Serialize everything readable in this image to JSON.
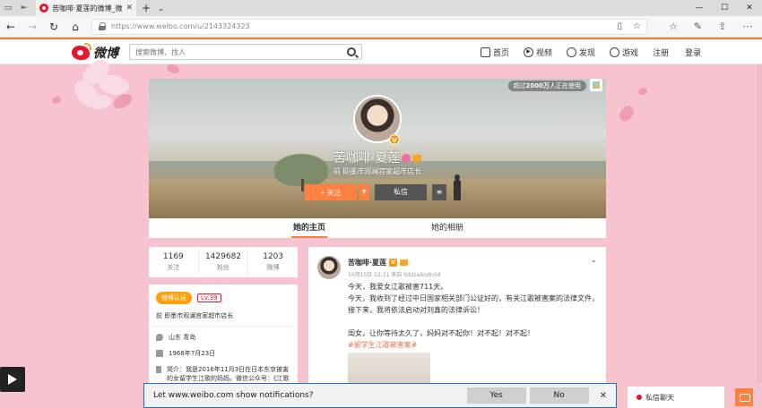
{
  "browser": {
    "tab_title": "苦咖啡·夏莲的微博_微博",
    "url_domain": "https://www.weibo.com",
    "url_path": "/u/2143324323"
  },
  "header": {
    "logo_text": "微博",
    "search_placeholder": "搜索微博、找人",
    "nav": [
      {
        "label": "首页",
        "icon": "home-icon"
      },
      {
        "label": "视频",
        "icon": "video-icon"
      },
      {
        "label": "发现",
        "icon": "compass-icon"
      },
      {
        "label": "游戏",
        "icon": "game-icon"
      }
    ],
    "register": "注册",
    "login": "登录"
  },
  "profile": {
    "live_badge_pre": "超过",
    "live_badge_num": "2000万",
    "live_badge_post": "人正在使用",
    "name": "苦咖啡·夏莲",
    "description": "前 即墨市观澜宫家超市店长",
    "follow_label": "+ 关注",
    "message_label": "私信",
    "tabs": [
      "她的主页",
      "她的相册"
    ]
  },
  "stats": [
    {
      "num": "1169",
      "label": "关注"
    },
    {
      "num": "1429682",
      "label": "粉丝"
    },
    {
      "num": "1203",
      "label": "微博"
    }
  ],
  "info": {
    "verified": "微博认证",
    "level": "Lv.39",
    "intro": "前 即墨市观澜宫家超市店长",
    "location": "山东 青岛",
    "birthday": "1968年7月23日",
    "bio": "简介：我是2016年11月3日在日本东京被害的女留学生江歌的妈妈。微信公众号：《江歌妈"
  },
  "post": {
    "author": "苦咖啡·夏莲",
    "meta": "10月15日 22:11 来自 biblzaAndroid",
    "lines": [
      "今天，我爱女江歌被害711天。",
      "今天，我收到了经过中日国家相关部门公证好的，有关江歌被害案的法律文件，",
      "接下来，我将依法启动对刘鑫的法律诉讼！",
      "",
      "闺女，让你等待太久了，妈妈对不起你！对不起！对不起！"
    ],
    "hashtag": "#留学生江歌被害案#"
  },
  "notification": {
    "message": "Let www.weibo.com show notifications?",
    "yes": "Yes",
    "no": "No"
  },
  "chat_label": "私信聊天"
}
